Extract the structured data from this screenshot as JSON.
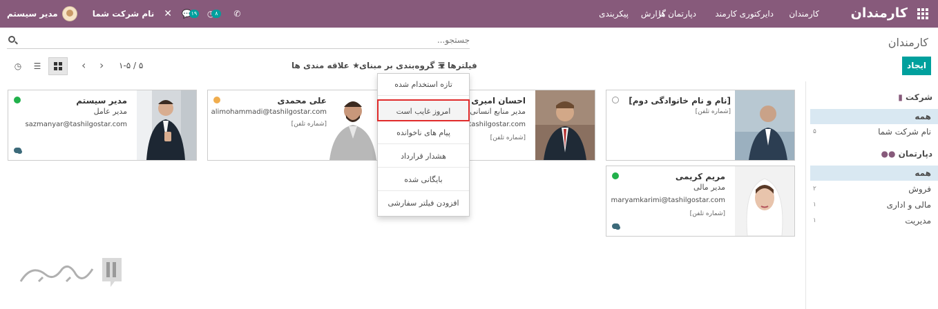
{
  "navbar": {
    "brand": "کارمندان",
    "menu": [
      "کارمندان",
      "دایرکتوری کارمند",
      "دپارتمان ها",
      "گزارش",
      "پیکربندی"
    ],
    "company": "نام شرکت شما",
    "user": "مدیر سیستم",
    "messages_count": "۱۹",
    "activities_count": "۸",
    "bar_color": "#875a7b"
  },
  "control_panel": {
    "title": "کارمندان",
    "search_placeholder": "جستجو...",
    "create_label": "ایجاد",
    "filters_label": "فیلترها",
    "groupby_label": "گروه‌بندی بر مبنای",
    "favorites_label": "علاقه مندی ها",
    "pager": "۱-۵ / ۵"
  },
  "filters_menu": {
    "items": [
      "تازه استخدام شده",
      "امروز غایب است",
      "پیام های ناخوانده",
      "هشدار قرارداد",
      "بایگانی شده",
      "افزودن فیلتر سفارشی"
    ],
    "highlighted_index": 1
  },
  "sidebar": {
    "company_title": "شرکت",
    "company_items": [
      {
        "label": "همه",
        "count": ""
      },
      {
        "label": "نام شرکت شما",
        "count": "۵"
      }
    ],
    "department_title": "دپارتمان",
    "department_items": [
      {
        "label": "همه",
        "count": ""
      },
      {
        "label": "فروش",
        "count": "۲"
      },
      {
        "label": "مالی و اداری",
        "count": "۱"
      },
      {
        "label": "مدیریت",
        "count": "۱"
      }
    ]
  },
  "employees": [
    {
      "name": "[نام و نام خانوادگی دوم]",
      "job": "",
      "email": "",
      "phone": "[شماره تلفن]",
      "status": "#ffffff"
    },
    {
      "name": "احسان امیری",
      "job": "مدیر منابع انسانی",
      "email": "@tashilgostar.com",
      "phone": "[شماره تلفن]",
      "status": ""
    },
    {
      "name": "علی محمدی",
      "job": "",
      "email": "alimohammadi@tashilgostar.com",
      "phone": "[شماره تلفن]",
      "status": "#f0ad4e"
    },
    {
      "name": "مدیر سیستم",
      "job": "مدیر عامل",
      "email": "sazmanyar@tashilgostar.com",
      "phone": "",
      "status": "#21b14b"
    },
    {
      "name": "مریم کریمی",
      "job": "مدیر مالی",
      "email": "maryamkarimi@tashilgostar.com",
      "phone": "[شماره تلفن]",
      "status": "#21b14b"
    }
  ],
  "accent": "#00a09d"
}
